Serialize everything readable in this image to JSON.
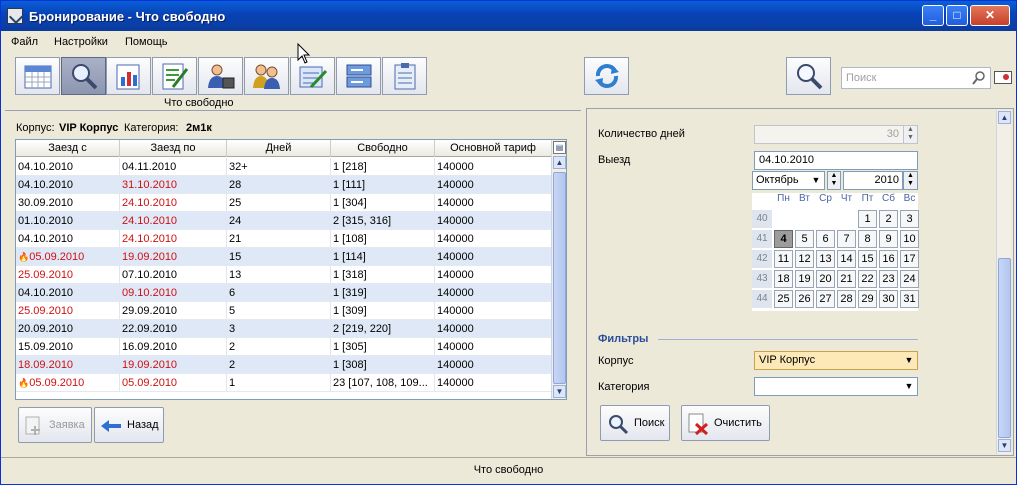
{
  "window": {
    "title": "Бронирование - Что свободно",
    "controls": {
      "minimize": "_",
      "maximize": "□",
      "close": "✕"
    }
  },
  "menu": [
    "Файл",
    "Настройки",
    "Помощь"
  ],
  "toolbar": {
    "buttons": [
      "calendar-icon",
      "search-zoom-icon",
      "report-chart-icon",
      "edit-document-icon",
      "person-badge-icon",
      "people-icon",
      "cards-edit-icon",
      "server-icon",
      "clipboard-list-icon"
    ],
    "active_caption": "Что свободно",
    "refresh_icon": "refresh-icon",
    "search_icon": "magnifier-icon",
    "search_placeholder": "Поиск"
  },
  "left": {
    "korpus_label": "Корпус:",
    "korpus_value": "VIP Корпус",
    "category_label": "Категория:",
    "category_value": "2м1к",
    "columns": [
      "Заезд с",
      "Заезд по",
      "Дней",
      "Свободно",
      "Основной тариф"
    ],
    "rows": [
      {
        "from": "04.10.2010",
        "to": "04.11.2010",
        "days": "32+",
        "free": "1 [218]",
        "tariff": "140000",
        "from_red": false,
        "to_red": false,
        "flame": false
      },
      {
        "from": "04.10.2010",
        "to": "31.10.2010",
        "days": "28",
        "free": "1 [111]",
        "tariff": "140000",
        "from_red": false,
        "to_red": true,
        "flame": false
      },
      {
        "from": "30.09.2010",
        "to": "24.10.2010",
        "days": "25",
        "free": "1 [304]",
        "tariff": "140000",
        "from_red": false,
        "to_red": true,
        "flame": false
      },
      {
        "from": "01.10.2010",
        "to": "24.10.2010",
        "days": "24",
        "free": "2 [315, 316]",
        "tariff": "140000",
        "from_red": false,
        "to_red": true,
        "flame": false
      },
      {
        "from": "04.10.2010",
        "to": "24.10.2010",
        "days": "21",
        "free": "1 [108]",
        "tariff": "140000",
        "from_red": false,
        "to_red": true,
        "flame": false
      },
      {
        "from": "05.09.2010",
        "to": "19.09.2010",
        "days": "15",
        "free": "1 [114]",
        "tariff": "140000",
        "from_red": true,
        "to_red": true,
        "flame": true
      },
      {
        "from": "25.09.2010",
        "to": "07.10.2010",
        "days": "13",
        "free": "1 [318]",
        "tariff": "140000",
        "from_red": true,
        "to_red": false,
        "flame": false
      },
      {
        "from": "04.10.2010",
        "to": "09.10.2010",
        "days": "6",
        "free": "1 [319]",
        "tariff": "140000",
        "from_red": false,
        "to_red": true,
        "flame": false
      },
      {
        "from": "25.09.2010",
        "to": "29.09.2010",
        "days": "5",
        "free": "1 [309]",
        "tariff": "140000",
        "from_red": true,
        "to_red": false,
        "flame": false
      },
      {
        "from": "20.09.2010",
        "to": "22.09.2010",
        "days": "3",
        "free": "2 [219, 220]",
        "tariff": "140000",
        "from_red": false,
        "to_red": false,
        "flame": false
      },
      {
        "from": "15.09.2010",
        "to": "16.09.2010",
        "days": "2",
        "free": "1 [305]",
        "tariff": "140000",
        "from_red": false,
        "to_red": false,
        "flame": false
      },
      {
        "from": "18.09.2010",
        "to": "19.09.2010",
        "days": "2",
        "free": "1 [308]",
        "tariff": "140000",
        "from_red": true,
        "to_red": true,
        "flame": false
      },
      {
        "from": "05.09.2010",
        "to": "05.09.2010",
        "days": "1",
        "free": "23 [107, 108, 109...",
        "tariff": "140000",
        "from_red": true,
        "to_red": true,
        "flame": true
      }
    ],
    "btn_request": "Заявка",
    "btn_back": "Назад"
  },
  "right": {
    "days_label": "Количество дней",
    "days_value": "30",
    "departure_label": "Выезд",
    "departure_value": "04.10.2010",
    "month": "Октябрь",
    "year": "2010",
    "dow": [
      "Пн",
      "Вт",
      "Ср",
      "Чт",
      "Пт",
      "Сб",
      "Вс"
    ],
    "weeks": [
      {
        "n": "40",
        "days": [
          "",
          "",
          "",
          "",
          "1",
          "2",
          "3"
        ]
      },
      {
        "n": "41",
        "days": [
          "4",
          "5",
          "6",
          "7",
          "8",
          "9",
          "10"
        ]
      },
      {
        "n": "42",
        "days": [
          "11",
          "12",
          "13",
          "14",
          "15",
          "16",
          "17"
        ]
      },
      {
        "n": "43",
        "days": [
          "18",
          "19",
          "20",
          "21",
          "22",
          "23",
          "24"
        ]
      },
      {
        "n": "44",
        "days": [
          "25",
          "26",
          "27",
          "28",
          "29",
          "30",
          "31"
        ]
      }
    ],
    "selected_day": "4",
    "filters_title": "Фильтры",
    "korpus_label": "Корпус",
    "korpus_value": "VIP Корпус",
    "category_label": "Категория",
    "category_value": "",
    "btn_search": "Поиск",
    "btn_clear": "Очистить"
  },
  "status": "Что свободно"
}
